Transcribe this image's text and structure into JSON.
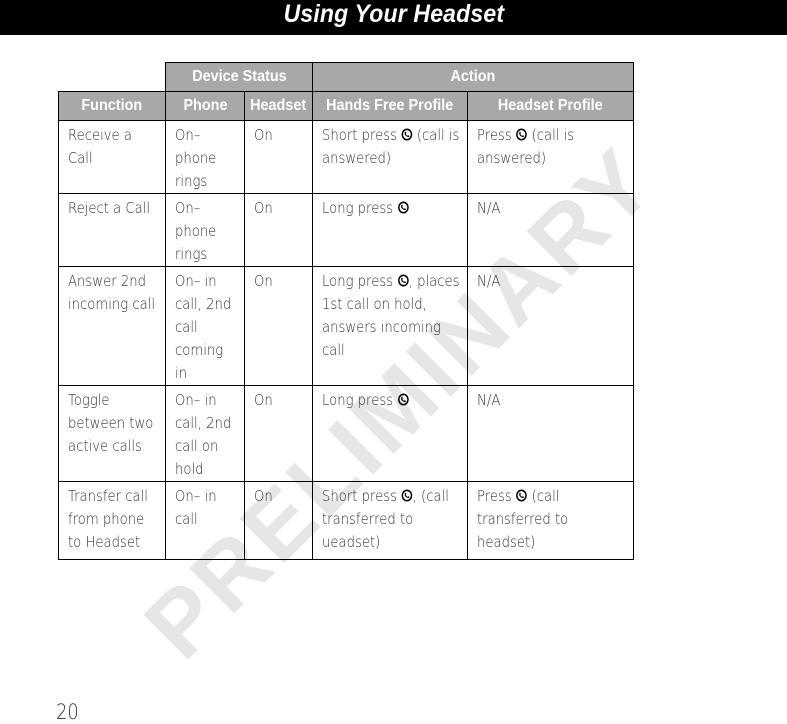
{
  "header": {
    "title": "Using Your Headset"
  },
  "watermark": "PRELIMINARY",
  "table": {
    "group_headers": {
      "device_status": "Device Status",
      "action": "Action"
    },
    "column_headers": {
      "function": "Function",
      "phone": "Phone",
      "headset": "Headset",
      "hands_free_profile": "Hands Free Profile",
      "headset_profile": "Headset Profile"
    },
    "icon_name": "phone-button-icon",
    "rows": [
      {
        "function": "Receive a Call",
        "phone": "On– phone rings",
        "headset": "On",
        "hfp_before": "Short press ",
        "hfp_has_icon": true,
        "hfp_after": " (call is answered)",
        "hsp_before": "Press ",
        "hsp_has_icon": true,
        "hsp_after": " (call is answered)"
      },
      {
        "function": "Reject a Call",
        "phone": "On– phone rings",
        "headset": "On",
        "hfp_before": "Long press ",
        "hfp_has_icon": true,
        "hfp_after": "",
        "hsp_before": "N/A",
        "hsp_has_icon": false,
        "hsp_after": ""
      },
      {
        "function": "Answer 2nd incoming call",
        "phone": "On– in call, 2nd call coming in",
        "headset": "On",
        "hfp_before": "Long press ",
        "hfp_has_icon": true,
        "hfp_after": ", places 1st call on hold, answers incoming call",
        "hsp_before": "N/A",
        "hsp_has_icon": false,
        "hsp_after": ""
      },
      {
        "function": "Toggle between two active calls",
        "phone": "On– in call, 2nd call on hold",
        "headset": "On",
        "hfp_before": "Long press ",
        "hfp_has_icon": true,
        "hfp_after": "",
        "hsp_before": "N/A",
        "hsp_has_icon": false,
        "hsp_after": ""
      },
      {
        "function": "Transfer call from phone to Headset",
        "phone": "On– in call",
        "headset": "On",
        "hfp_before": "Short press ",
        "hfp_has_icon": true,
        "hfp_after": ", (call transferred to ueadset)",
        "hsp_before": "Press ",
        "hsp_has_icon": true,
        "hsp_after": " (call transferred to headset)"
      }
    ]
  },
  "footer": {
    "page_number": "20"
  }
}
